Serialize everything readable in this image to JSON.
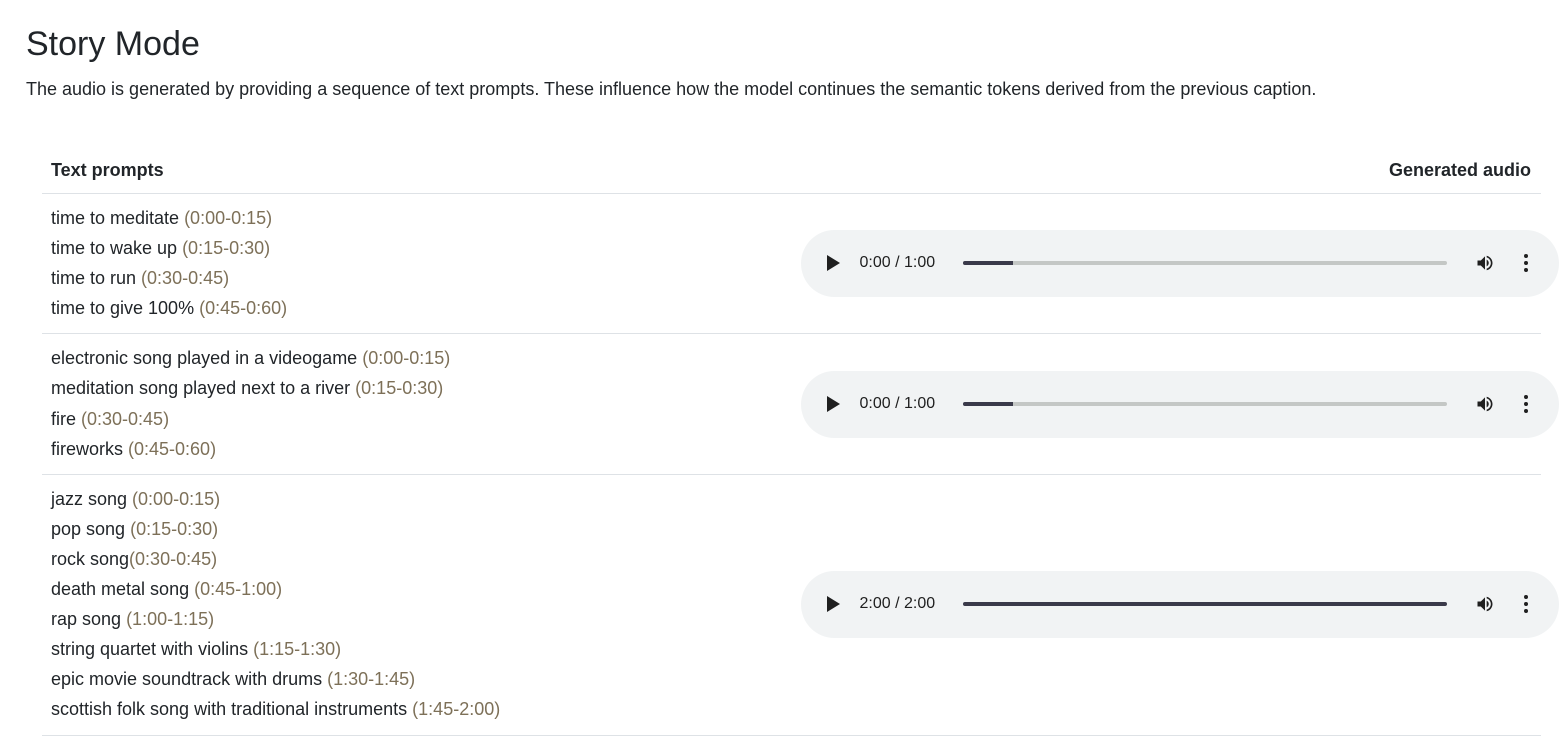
{
  "page": {
    "title": "Story Mode",
    "description": "The audio is generated by providing a sequence of text prompts. These influence how the model continues the semantic tokens derived from the previous caption."
  },
  "table": {
    "header_prompts": "Text prompts",
    "header_audio": "Generated audio",
    "rows": [
      {
        "prompts": [
          {
            "text": "time to meditate ",
            "time": "(0:00-0:15)"
          },
          {
            "text": "time to wake up ",
            "time": "(0:15-0:30)"
          },
          {
            "text": "time to run ",
            "time": "(0:30-0:45)"
          },
          {
            "text": "time to give 100% ",
            "time": "(0:45-0:60)"
          }
        ],
        "audio": {
          "time_display": "0:00 / 1:00",
          "buffered_fraction": 0.105,
          "played_fraction": 0.0
        }
      },
      {
        "prompts": [
          {
            "text": "electronic song played in a videogame ",
            "time": "(0:00-0:15)"
          },
          {
            "text": "meditation song played next to a river ",
            "time": "(0:15-0:30)"
          },
          {
            "text": "fire ",
            "time": "(0:30-0:45)"
          },
          {
            "text": "fireworks ",
            "time": "(0:45-0:60)"
          }
        ],
        "audio": {
          "time_display": "0:00 / 1:00",
          "buffered_fraction": 0.105,
          "played_fraction": 0.0
        }
      },
      {
        "prompts": [
          {
            "text": "jazz song ",
            "time": "(0:00-0:15)"
          },
          {
            "text": "pop song ",
            "time": "(0:15-0:30)"
          },
          {
            "text": "rock song",
            "time": "(0:30-0:45)"
          },
          {
            "text": "death metal song ",
            "time": "(0:45-1:00)"
          },
          {
            "text": "rap song ",
            "time": "(1:00-1:15)"
          },
          {
            "text": "string quartet with violins ",
            "time": "(1:15-1:30)"
          },
          {
            "text": "epic movie soundtrack with drums ",
            "time": "(1:30-1:45)"
          },
          {
            "text": "scottish folk song with traditional instruments ",
            "time": "(1:45-2:00)"
          }
        ],
        "audio": {
          "time_display": "2:00 / 2:00",
          "buffered_fraction": 1.0,
          "played_fraction": 1.0
        }
      }
    ]
  },
  "icons": {
    "play": "play-icon",
    "volume": "volume-icon",
    "menu": "more-vertical-icon"
  },
  "colors": {
    "text": "#212529",
    "time_range": "#7d7058",
    "player_bg": "#f1f3f4",
    "progress_fill": "#3a3a4a",
    "progress_track": "#c4c7c5"
  }
}
